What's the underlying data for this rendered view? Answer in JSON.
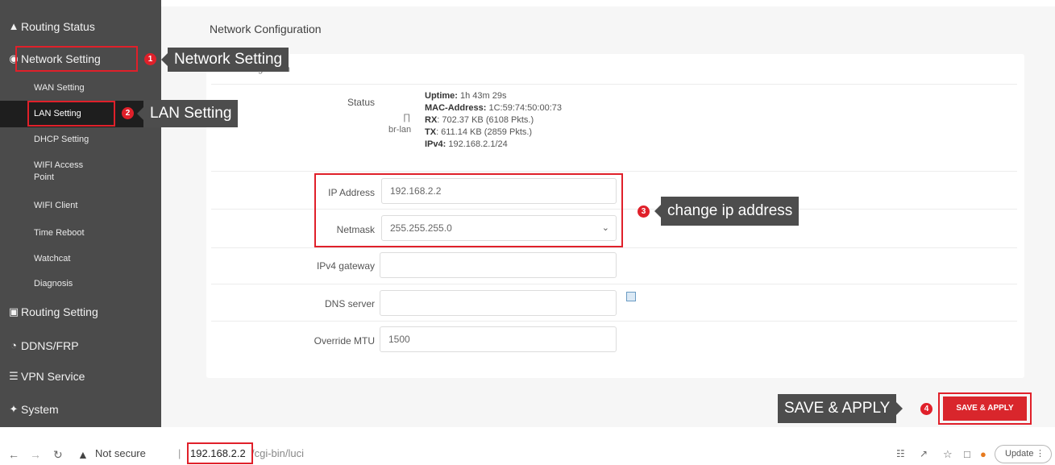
{
  "sidebar": {
    "routing_status": "Routing Status",
    "network_setting": "Network Setting",
    "wan_setting": "WAN Setting",
    "lan_setting": "LAN Setting",
    "dhcp_setting": "DHCP Setting",
    "wifi_ap_line1": "WIFI Access",
    "wifi_ap_line2": "Point",
    "wifi_client": "WIFI Client",
    "time_reboot": "Time Reboot",
    "watchcat": "Watchcat",
    "diagnosis": "Diagnosis",
    "routing_setting": "Routing Setting",
    "ddns_frp": "DDNS/FRP",
    "vpn_service": "VPN Service",
    "system": "System"
  },
  "main": {
    "page_title": "Network Configuration",
    "section_label": "LAN Configuration",
    "status_label": "Status",
    "iface_name": "br-lan",
    "uptime_key": "Uptime:",
    "uptime_val": "1h 43m 29s",
    "mac_key": "MAC-Address:",
    "mac_val": "1C:59:74:50:00:73",
    "rx_key": "RX",
    "rx_val": ": 702.37 KB (6108 Pkts.)",
    "tx_key": "TX",
    "tx_val": ": 611.14 KB (2859 Pkts.)",
    "ipv4_key": "IPv4:",
    "ipv4_val": "192.168.2.1/24",
    "ip_address_label": "IP Address",
    "ip_address_value": "192.168.2.2",
    "netmask_label": "Netmask",
    "netmask_value": "255.255.255.0",
    "gateway_label": "IPv4 gateway",
    "gateway_value": "",
    "dns_label": "DNS server",
    "dns_value": "",
    "mtu_label": "Override MTU",
    "mtu_value": "1500",
    "save_apply_btn": "SAVE & APPLY"
  },
  "annotations": {
    "n1": "1",
    "n2": "2",
    "n3": "3",
    "n4": "4",
    "network_setting": "Network Setting",
    "lan_setting": "LAN Setting",
    "change_ip": "change ip address",
    "save_apply": "SAVE & APPLY"
  },
  "browser": {
    "not_secure": "Not secure",
    "separator": "|",
    "url_host": "192.168.2.2",
    "url_path": "/cgi-bin/luci",
    "update": "Update"
  },
  "colors": {
    "sidebar_bg": "#4b4b4b",
    "accent_red": "#e0202a",
    "callout_bg": "#4d4d4d"
  }
}
